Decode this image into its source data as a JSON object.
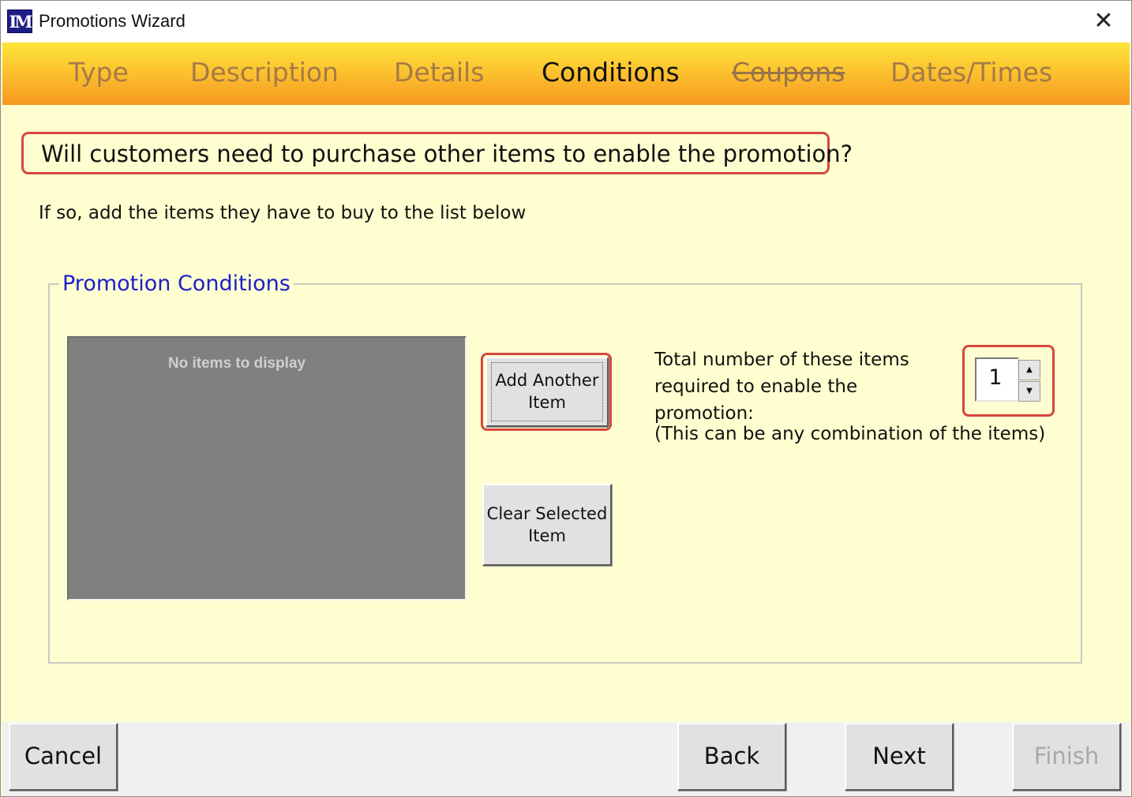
{
  "window": {
    "title": "Promotions Wizard",
    "icon": "im-logo",
    "close_glyph": "✕"
  },
  "tabs": [
    {
      "label": "Type",
      "state": "normal"
    },
    {
      "label": "Description",
      "state": "normal"
    },
    {
      "label": "Details",
      "state": "normal"
    },
    {
      "label": "Conditions",
      "state": "active"
    },
    {
      "label": "Coupons",
      "state": "disabled"
    },
    {
      "label": "Dates/Times",
      "state": "normal"
    }
  ],
  "question": "Will customers need to purchase other items to enable the promotion?",
  "instruction": "If so, add the items they have to buy to the list below",
  "conditions": {
    "group_title": "Promotion Conditions",
    "empty_list_text": "No items to display",
    "add_item_line1": "Add Another",
    "add_item_line2": "Item",
    "clear_item_line1": "Clear Selected",
    "clear_item_line2": "Item",
    "total_label_line1": "Total number of these items",
    "total_label_line2": "required to enable the promotion:",
    "total_value": "1",
    "spin_up_glyph": "▲",
    "spin_down_glyph": "▼",
    "combination_note": "(This can be any combination of the items)"
  },
  "footer": {
    "cancel": "Cancel",
    "back": "Back",
    "next": "Next",
    "finish": "Finish"
  },
  "colors": {
    "highlight": "#d6473f",
    "background": "#fffed0",
    "group_title": "#1c20cc",
    "tab_inactive": "#a47a48",
    "list_background": "#808080"
  }
}
